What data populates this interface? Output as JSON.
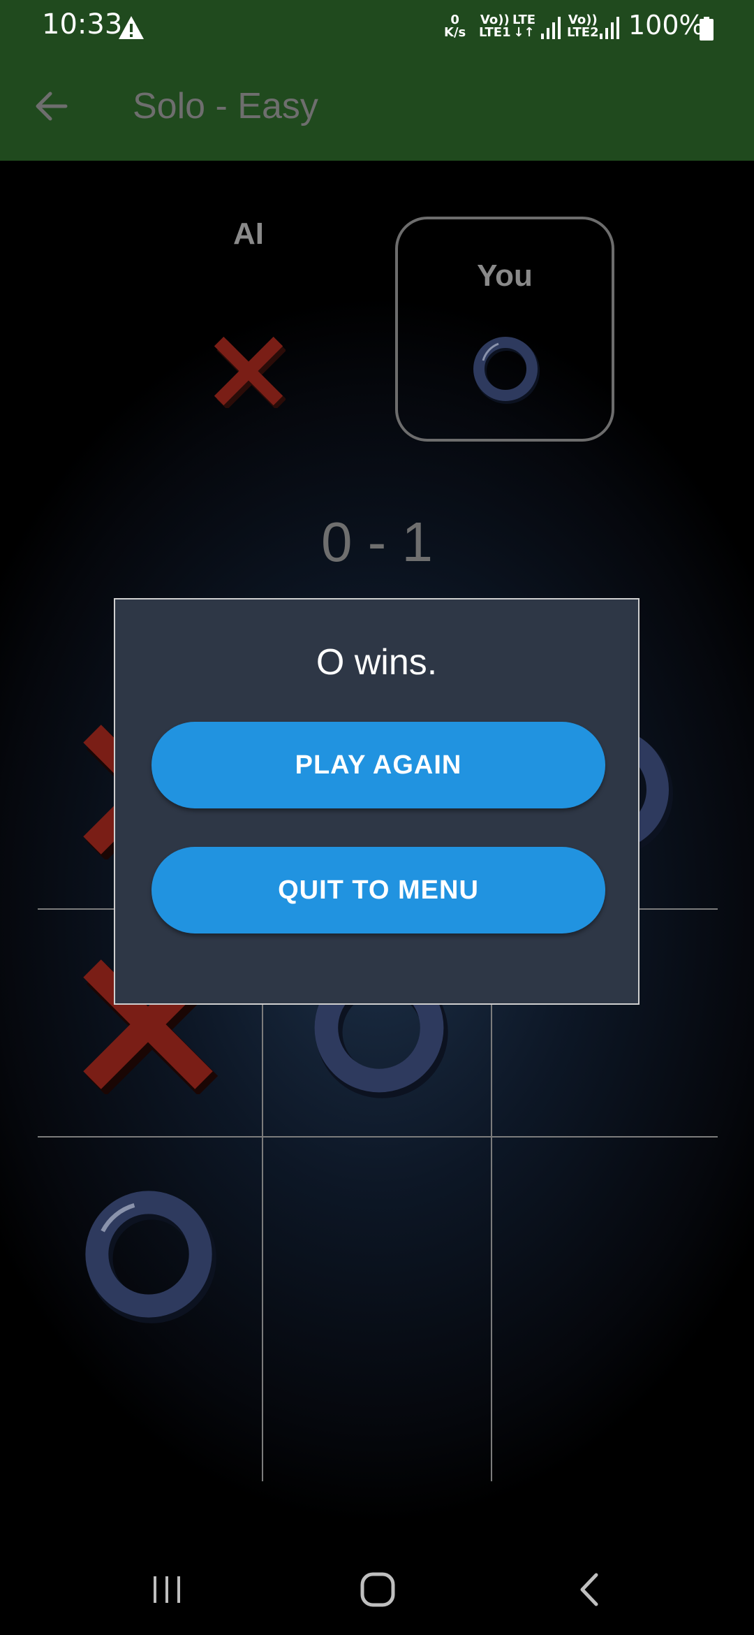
{
  "status_bar": {
    "time": "10:33",
    "net_speed_top": "0",
    "net_speed_bottom": "K/s",
    "sim1_top": "Vo))",
    "sim1_bottom": "LTE1",
    "lte_label": "LTE",
    "sim2_top": "Vo))",
    "sim2_bottom": "LTE2",
    "battery": "100%"
  },
  "app_bar": {
    "title": "Solo - Easy"
  },
  "players": {
    "ai_label": "AI",
    "you_label": "You",
    "active_player": "You"
  },
  "score": "0 - 1",
  "board": {
    "cells": [
      "X",
      "",
      "O",
      "X",
      "O",
      "",
      "O",
      "",
      ""
    ]
  },
  "dialog": {
    "message": "O wins.",
    "play_again_label": "PLAY AGAIN",
    "quit_label": "QUIT TO MENU"
  },
  "colors": {
    "app_bar": "#204a1e",
    "x_mark": "#7a1e16",
    "o_mark": "#2e3a5e",
    "dialog_bg": "#2e3746",
    "button": "#2193e0"
  }
}
